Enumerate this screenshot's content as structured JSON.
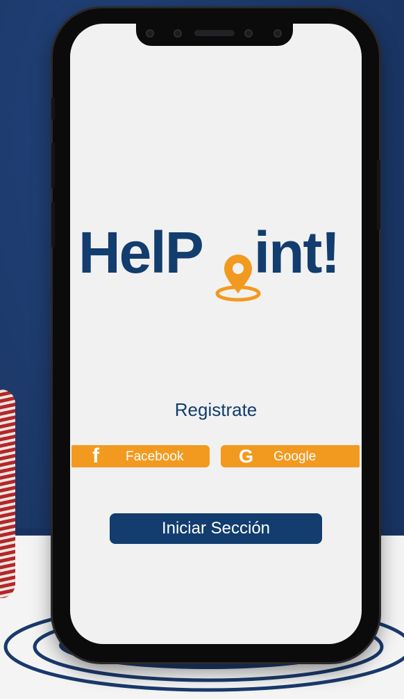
{
  "app": {
    "logo_text_left": "HelP",
    "logo_text_right": "int!"
  },
  "screen": {
    "register_label": "Registrate",
    "facebook_label": "Facebook",
    "google_label": "Google",
    "facebook_glyph": "f",
    "google_glyph": "G",
    "login_label": "Iniciar Sección"
  },
  "colors": {
    "brand_navy": "#123d6e",
    "accent_orange": "#f29a1f",
    "background_blue": "#1b3766",
    "screen_bg": "#f1f1f1"
  },
  "icons": {
    "logo_pin": "location-pin-icon",
    "facebook": "facebook-icon",
    "google": "google-icon"
  }
}
